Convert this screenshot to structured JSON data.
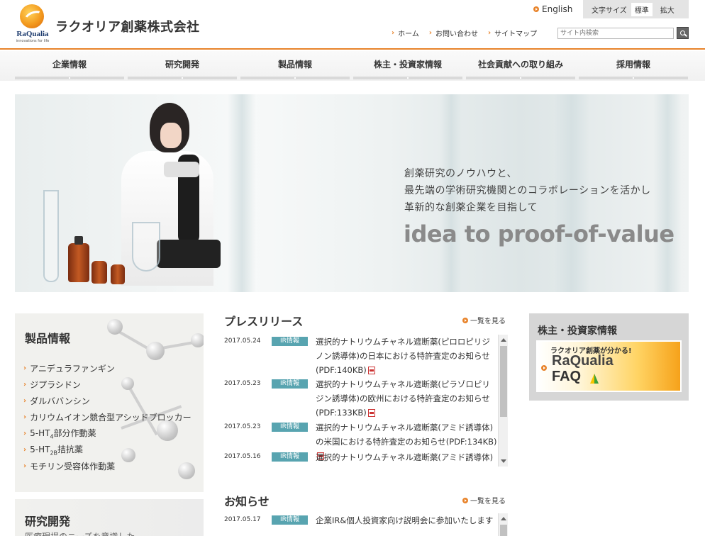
{
  "header": {
    "logo_text": "RaQualia",
    "logo_sub": "innovations for life",
    "company_name": "ラクオリア創薬株式会社",
    "lang_link": "English",
    "font_size_label": "文字サイズ",
    "font_size_options": [
      "標準",
      "拡大"
    ],
    "util_nav": [
      "ホーム",
      "お問い合わせ",
      "サイトマップ"
    ],
    "search_placeholder": "サイト内検索"
  },
  "gnav": [
    "企業情報",
    "研究開発",
    "製品情報",
    "株主・投資家情報",
    "社会貢献への取り組み",
    "採用情報"
  ],
  "hero": {
    "lines": [
      "創薬研究のノウハウと、",
      "最先端の学術研究機関とのコラボレーションを活かし",
      "革新的な創薬企業を目指して"
    ],
    "tagline": "idea to proof-of-value"
  },
  "products": {
    "title": "製品情報",
    "items": [
      {
        "main": "アニデュラファンギン",
        "sub": "",
        "tail": ""
      },
      {
        "main": "ジプラシドン",
        "sub": "",
        "tail": ""
      },
      {
        "main": "ダルババンシン",
        "sub": "",
        "tail": ""
      },
      {
        "main": "カリウムイオン競合型アシッドブロッカー",
        "sub": "",
        "tail": ""
      },
      {
        "main": "5-HT",
        "sub": "4",
        "tail": "部分作動薬"
      },
      {
        "main": "5-HT",
        "sub": "2B",
        "tail": "拮抗薬"
      },
      {
        "main": "モチリン受容体作動薬",
        "sub": "",
        "tail": ""
      }
    ]
  },
  "research": {
    "title": "研究開発",
    "desc": "医療現場のニーズを意識した"
  },
  "press": {
    "title": "プレスリリース",
    "more": "一覧を見る",
    "items": [
      {
        "date": "2017.05.24",
        "badge": "IR情報",
        "text": "選択的ナトリウムチャネル遮断薬(ピロロピリジノン誘導体)の日本における特許査定のお知らせ(PDF:140KB)"
      },
      {
        "date": "2017.05.23",
        "badge": "IR情報",
        "text": "選択的ナトリウムチャネル遮断薬(ピラゾロピリジン誘導体)の欧州における特許査定のお知らせ(PDF:133KB)"
      },
      {
        "date": "2017.05.23",
        "badge": "IR情報",
        "text": "選択的ナトリウムチャネル遮断薬(アミド誘導体)の米国における特許査定のお知らせ(PDF:134KB)"
      },
      {
        "date": "2017.05.16",
        "badge": "IR情報",
        "text": "選択的ナトリウムチャネル遮断薬(アミド誘導体)の"
      }
    ]
  },
  "notice": {
    "title": "お知らせ",
    "more": "一覧を見る",
    "items": [
      {
        "date": "2017.05.17",
        "badge": "IR情報",
        "text": "企業IR&個人投資家向け説明会に参加いたします"
      }
    ]
  },
  "investor": {
    "title": "株主・投資家情報",
    "faq_line1": "ラクオリア創薬が分かる!",
    "faq_line2": "RaQualia",
    "faq_line3": "FAQ"
  },
  "colors": {
    "accent": "#e8832a",
    "badge": "#58a4b0",
    "brand_navy": "#1c3a6d"
  }
}
